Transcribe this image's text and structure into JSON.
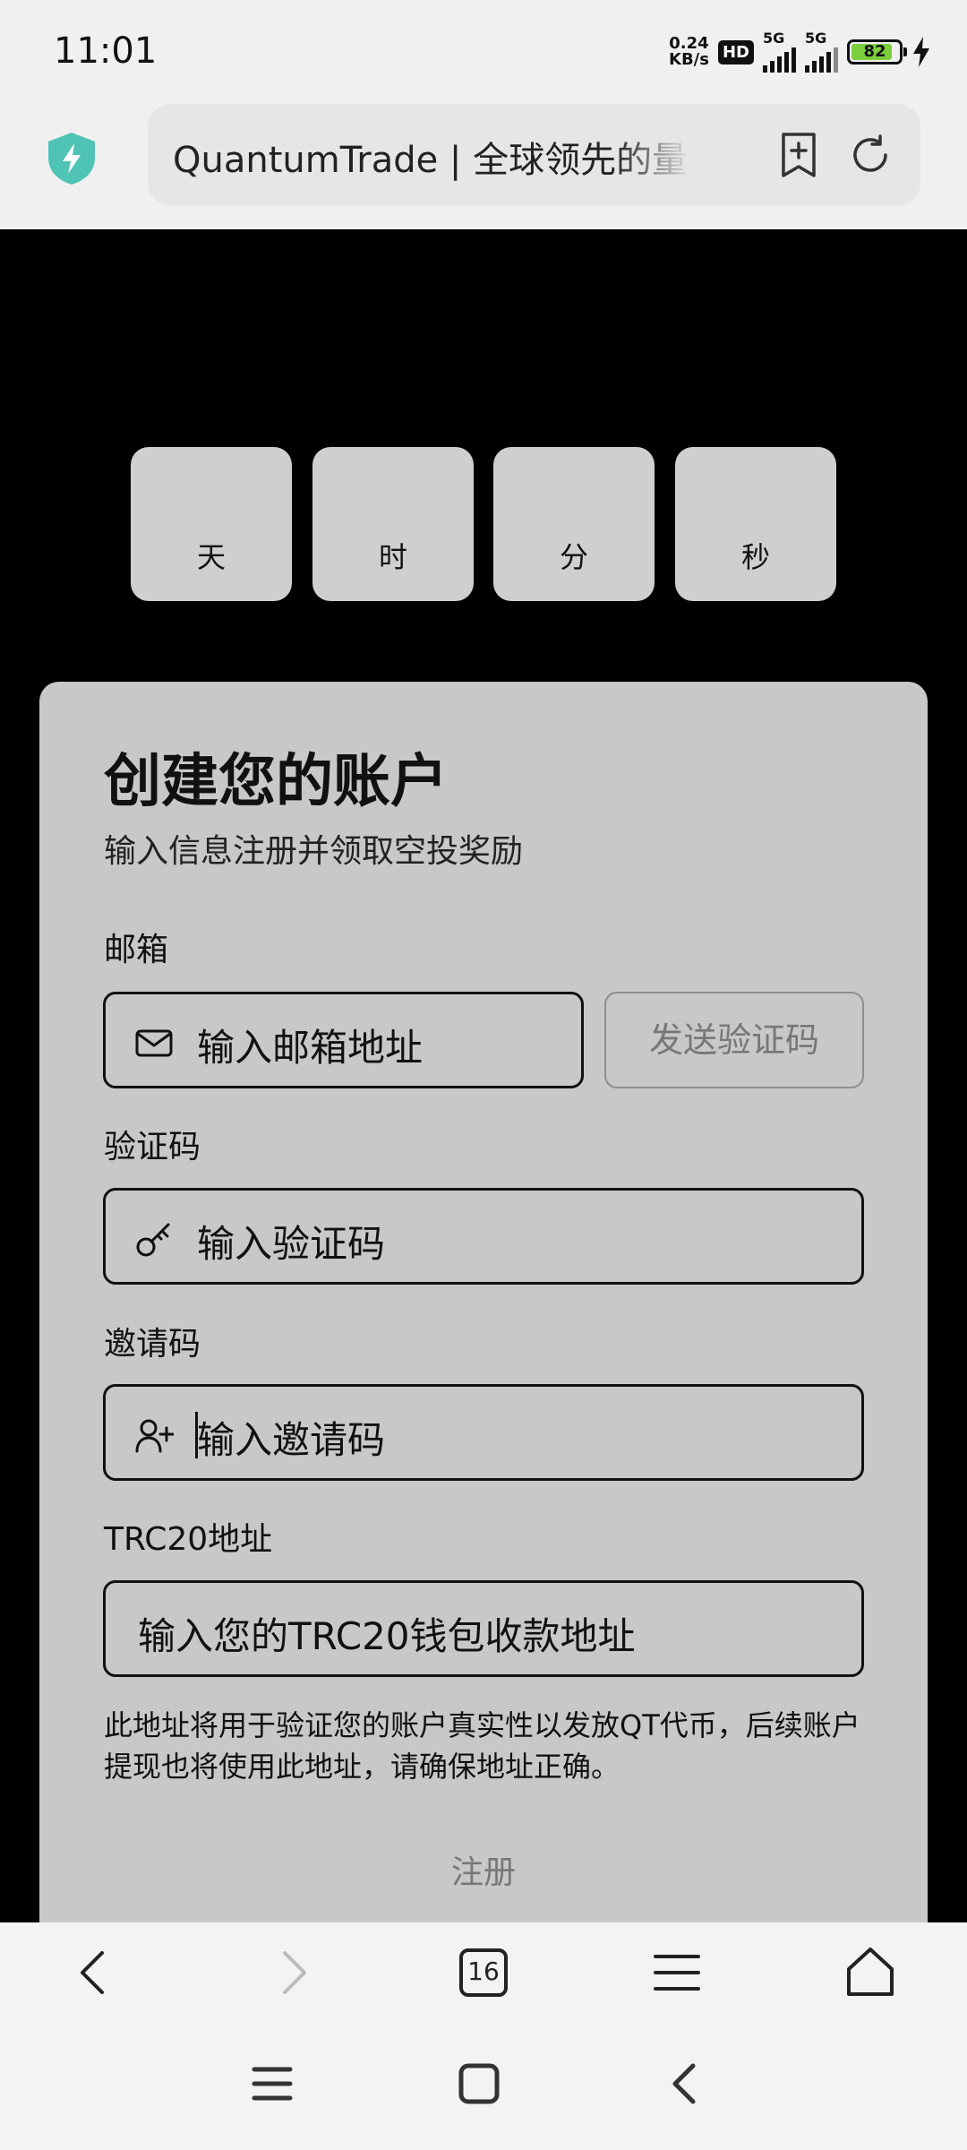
{
  "status_bar": {
    "time": "11:01",
    "net_speed_value": "0.24",
    "net_speed_unit": "KB/s",
    "hd_badge": "HD",
    "signal1_label": "5G",
    "signal2_label": "5G",
    "battery": "82"
  },
  "browser": {
    "url_text": "QuantumTrade | 全球领先的量子",
    "shield_color": "#4fc3b4"
  },
  "countdown": {
    "units": [
      "天",
      "时",
      "分",
      "秒"
    ]
  },
  "signup": {
    "title": "创建您的账户",
    "subtitle": "输入信息注册并领取空投奖励",
    "email_label": "邮箱",
    "email_placeholder": "输入邮箱地址",
    "send_code_label": "发送验证码",
    "code_label": "验证码",
    "code_placeholder": "输入验证码",
    "invite_label": "邀请码",
    "invite_placeholder": "输入邀请码",
    "trc20_label": "TRC20地址",
    "trc20_placeholder": "输入您的TRC20钱包收款地址",
    "notice": "此地址将用于验证您的账户真实性以发放QT代币，后续账户提现也将使用此地址，请确保地址正确。",
    "register_label": "注册"
  },
  "bottom_nav": {
    "tab_count": "16"
  }
}
